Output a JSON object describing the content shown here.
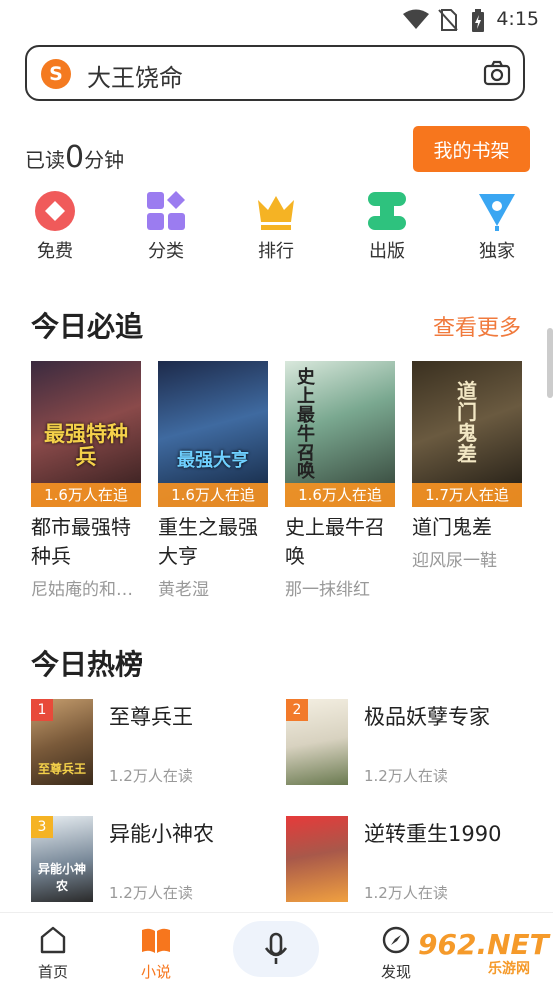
{
  "status_bar": {
    "time": "4:15"
  },
  "search": {
    "query": "大王饶命",
    "logo_letter": "S"
  },
  "reading": {
    "prefix": "已读",
    "minutes": "0",
    "suffix": "分钟"
  },
  "shelf_button": "我的书架",
  "categories": [
    {
      "label": "免费",
      "icon": "free-icon",
      "color": "#f05a5a"
    },
    {
      "label": "分类",
      "icon": "category-icon",
      "color": "#9b7cf0"
    },
    {
      "label": "排行",
      "icon": "crown-icon",
      "color": "#f5b324"
    },
    {
      "label": "出版",
      "icon": "publish-icon",
      "color": "#2ec27e"
    },
    {
      "label": "独家",
      "icon": "exclusive-icon",
      "color": "#3aa6f2"
    }
  ],
  "today_must_read": {
    "title": "今日必追",
    "more": "查看更多",
    "books": [
      {
        "cover_text": "最强特种兵",
        "readers": "1.6万人在追",
        "title": "都市最强特种兵",
        "author": "尼姑庵的和…"
      },
      {
        "cover_text": "最强大亨",
        "readers": "1.6万人在追",
        "title": "重生之最强大亨",
        "author": "黄老湿"
      },
      {
        "cover_text": "史上最牛召唤",
        "readers": "1.6万人在追",
        "title": "史上最牛召唤",
        "author": "那一抹绯红"
      },
      {
        "cover_text": "道门鬼差",
        "readers": "1.7万人在追",
        "title": "道门鬼差",
        "author": "迎风尿一鞋"
      }
    ]
  },
  "hot_ranking": {
    "title": "今日热榜",
    "items": [
      {
        "rank": "1",
        "title": "至尊兵王",
        "count": "1.2万人在读",
        "cover_text": "至尊兵王"
      },
      {
        "rank": "2",
        "title": "极品妖孽专家",
        "count": "1.2万人在读",
        "cover_text": ""
      },
      {
        "rank": "3",
        "title": "异能小神农",
        "count": "1.2万人在读",
        "cover_text": "异能小神农"
      },
      {
        "rank": "",
        "title": "逆转重生1990",
        "count": "1.2万人在读",
        "cover_text": ""
      }
    ]
  },
  "bottom_nav": [
    {
      "label": "首页",
      "icon": "home-icon"
    },
    {
      "label": "小说",
      "icon": "book-icon",
      "active": true
    },
    {
      "label": "发现",
      "icon": "compass-icon"
    }
  ],
  "watermark": {
    "big": "962.NET",
    "small": "乐游网"
  },
  "colors": {
    "accent": "#f7761d",
    "badge": "#f69223"
  }
}
